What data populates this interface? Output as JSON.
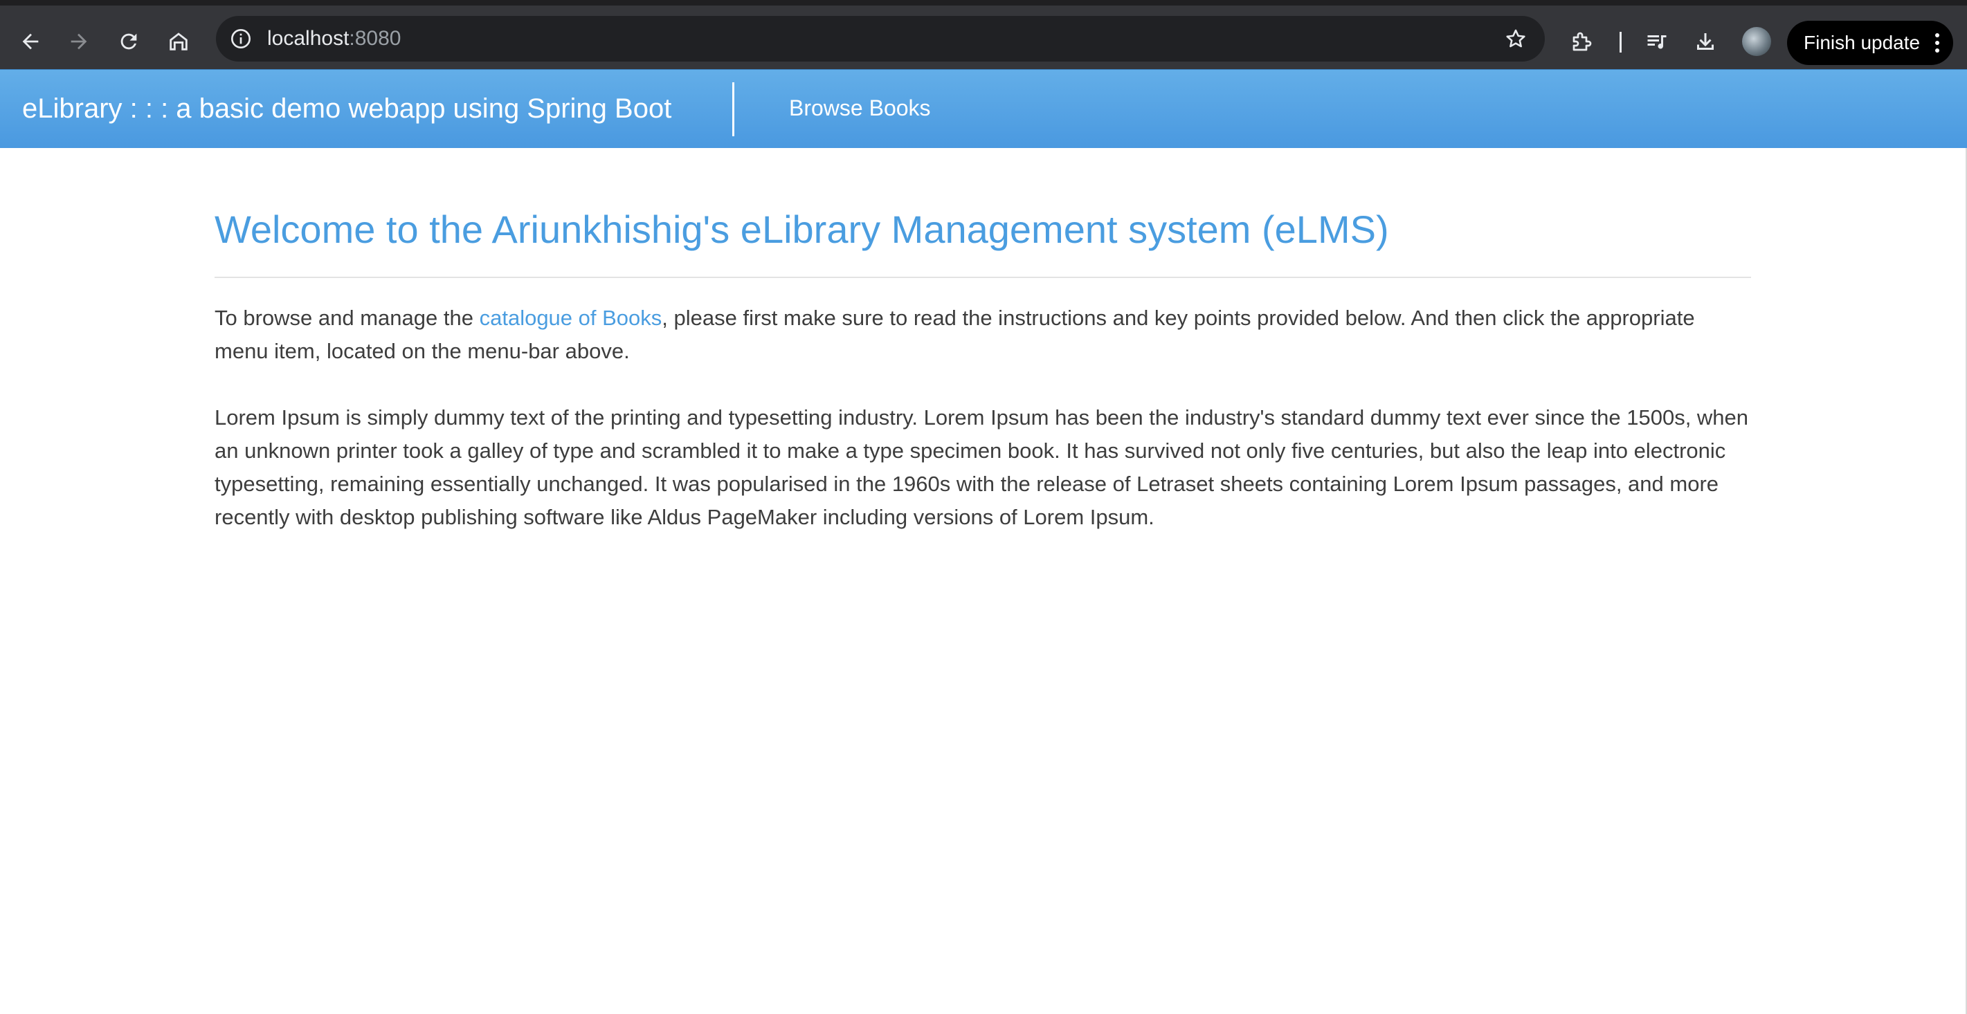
{
  "browser": {
    "url_host": "localhost",
    "url_port": ":8080",
    "update_button_label": "Finish update",
    "icons": {
      "back": "arrow-left-icon",
      "forward": "arrow-right-icon",
      "reload": "reload-icon",
      "home": "home-icon",
      "site_info": "info-icon",
      "bookmark": "star-icon",
      "extensions": "puzzle-icon",
      "media": "queue-music-icon",
      "downloads": "download-icon",
      "menu": "kebab-menu-icon"
    }
  },
  "navbar": {
    "brand": "eLibrary : : : a basic demo webapp using Spring Boot",
    "links": [
      {
        "label": "Browse Books"
      }
    ],
    "colors": {
      "top": "#63aee8",
      "bottom": "#4a99e0"
    }
  },
  "main": {
    "title": "Welcome to the Ariunkhishig's eLibrary Management system (eLMS)",
    "intro": {
      "before_link": "To browse and manage the ",
      "link_text": "catalogue of Books",
      "after_link": ", please first make sure to read the instructions and key points provided below. And then click the appropriate menu item, located on the menu-bar above."
    },
    "body": "Lorem Ipsum is simply dummy text of the printing and typesetting industry. Lorem Ipsum has been the industry's standard dummy text ever since the 1500s, when an unknown printer took a galley of type and scrambled it to make a type specimen book. It has survived not only five centuries, but also the leap into electronic typesetting, remaining essentially unchanged. It was popularised in the 1960s with the release of Letraset sheets containing Lorem Ipsum passages, and more recently with desktop publishing software like Aldus PageMaker including versions of Lorem Ipsum.",
    "accent_color": "#4a9de0"
  }
}
